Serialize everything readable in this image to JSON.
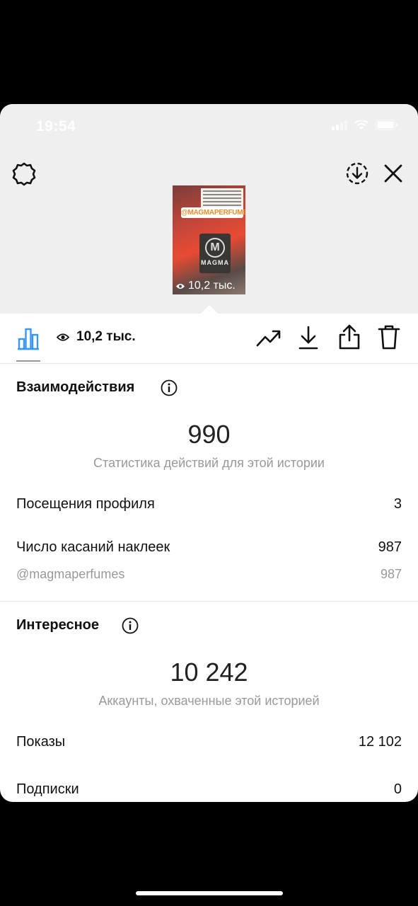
{
  "status": {
    "time": "19:54"
  },
  "story": {
    "thumb_tag": "@MAGMAPERFUMES",
    "thumb_brand": "MAGMA",
    "thumb_logo": "M",
    "thumb_views": "10,2 тыс."
  },
  "toolbar": {
    "views": "10,2 тыс.",
    "icons": [
      "bar-chart-icon",
      "eye-icon",
      "trending-up-icon",
      "download-icon",
      "share-icon",
      "trash-icon"
    ]
  },
  "interactions": {
    "title": "Взаимодействия",
    "total": "990",
    "caption": "Статистика действий для этой истории",
    "profile_visits_label": "Посещения профиля",
    "profile_visits_value": "3",
    "sticker_taps_label": "Число касаний наклеек",
    "sticker_taps_value": "987",
    "mention_label": "@magmaperfumes",
    "mention_value": "987"
  },
  "discovery": {
    "title": "Интересное",
    "total": "10 242",
    "caption": "Аккаунты, охваченные этой историей",
    "impressions_label": "Показы",
    "impressions_value": "12 102",
    "follows_label": "Подписки",
    "follows_value": "0"
  },
  "colors": {
    "accent": "#3897f0",
    "muted": "#999999"
  }
}
